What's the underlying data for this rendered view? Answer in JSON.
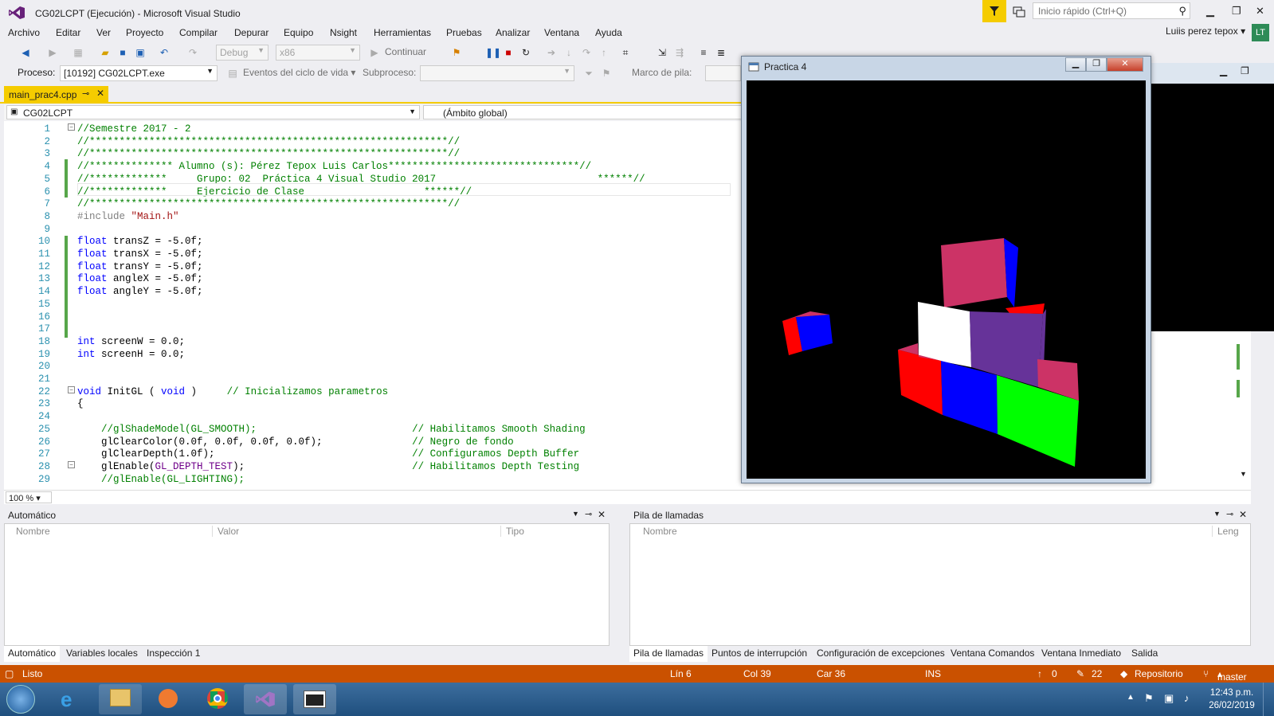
{
  "window": {
    "title": "CG02LCPT (Ejecución) - Microsoft Visual Studio"
  },
  "quick_launch": {
    "placeholder": "Inicio rápido (Ctrl+Q)"
  },
  "menu": [
    "Archivo",
    "Editar",
    "Ver",
    "Proyecto",
    "Compilar",
    "Depurar",
    "Equipo",
    "Nsight",
    "Herramientas",
    "Pruebas",
    "Analizar",
    "Ventana",
    "Ayuda"
  ],
  "user": {
    "name": "Luiis perez tepox",
    "initials": "LT"
  },
  "toolbar": {
    "config": "Debug",
    "platform": "x86",
    "continue_label": "Continuar"
  },
  "debugbar": {
    "process_label": "Proceso:",
    "process_value": "[10192] CG02LCPT.exe",
    "events_label": "Eventos del ciclo de vida",
    "thread_label": "Subproceso:",
    "stack_label": "Marco de pila:"
  },
  "doc_tab": {
    "name": "main_prac4.cpp"
  },
  "nav": {
    "project": "CG02LCPT",
    "scope": "(Ámbito global)"
  },
  "editor": {
    "zoom": "100 %",
    "lines": [
      {
        "n": "1",
        "t": "//Semestre 2017 - 2"
      },
      {
        "n": "2",
        "t": "//************************************************************//"
      },
      {
        "n": "3",
        "t": "//************************************************************//"
      },
      {
        "n": "4",
        "t": "//************** Alumno (s): Pérez Tepox Luis Carlos********************************//"
      },
      {
        "n": "5",
        "t": "//*************     Grupo: 02  Práctica 4 Visual Studio 2017                           ******//"
      },
      {
        "n": "6",
        "t": "//*************     Ejercicio de Clase                    ******//"
      },
      {
        "n": "7",
        "t": "//************************************************************//"
      },
      {
        "n": "8",
        "t": "#include \"Main.h\""
      },
      {
        "n": "9",
        "t": ""
      },
      {
        "n": "10",
        "t": "float transZ = -5.0f;"
      },
      {
        "n": "11",
        "t": "float transX = -5.0f;"
      },
      {
        "n": "12",
        "t": "float transY = -5.0f;"
      },
      {
        "n": "13",
        "t": "float angleX = -5.0f;"
      },
      {
        "n": "14",
        "t": "float angleY = -5.0f;"
      },
      {
        "n": "15",
        "t": ""
      },
      {
        "n": "16",
        "t": ""
      },
      {
        "n": "17",
        "t": ""
      },
      {
        "n": "18",
        "t": "int screenW = 0.0;"
      },
      {
        "n": "19",
        "t": "int screenH = 0.0;"
      },
      {
        "n": "20",
        "t": ""
      },
      {
        "n": "21",
        "t": ""
      },
      {
        "n": "22",
        "t": "void InitGL ( void )     // Inicializamos parametros"
      },
      {
        "n": "23",
        "t": "{"
      },
      {
        "n": "24",
        "t": ""
      },
      {
        "n": "25",
        "t": "    //glShadeModel(GL_SMOOTH);                          // Habilitamos Smooth Shading"
      },
      {
        "n": "26",
        "t": "    glClearColor(0.0f, 0.0f, 0.0f, 0.0f);               // Negro de fondo"
      },
      {
        "n": "27",
        "t": "    glClearDepth(1.0f);                                 // Configuramos Depth Buffer"
      },
      {
        "n": "28",
        "t": "    glEnable(GL_DEPTH_TEST);                            // Habilitamos Depth Testing"
      },
      {
        "n": "29",
        "t": "    //glEnable(GL_LIGHTING);"
      }
    ]
  },
  "practica_window": {
    "title": "Practica 4"
  },
  "auto_panel": {
    "title": "Automático",
    "cols": [
      "Nombre",
      "Valor",
      "Tipo"
    ],
    "tabs": [
      "Automático",
      "Variables locales",
      "Inspección 1"
    ]
  },
  "calls_panel": {
    "title": "Pila de llamadas",
    "cols": [
      "Nombre",
      "Leng"
    ],
    "tabs": [
      "Pila de llamadas",
      "Puntos de interrupción",
      "Configuración de excepciones",
      "Ventana Comandos",
      "Ventana Inmediato",
      "Salida"
    ]
  },
  "status": {
    "state": "Listo",
    "line": "Lín 6",
    "col": "Col 39",
    "car": "Car 36",
    "ins": "INS",
    "up": "0",
    "edits": "22",
    "repo": "Repositorio",
    "branch": "master"
  },
  "clock": {
    "time": "12:43 p.m.",
    "date": "26/02/2019"
  },
  "colors": {
    "accent": "#f5cc00",
    "status": "#ca5100",
    "taskbar": "#2a5a8a"
  }
}
